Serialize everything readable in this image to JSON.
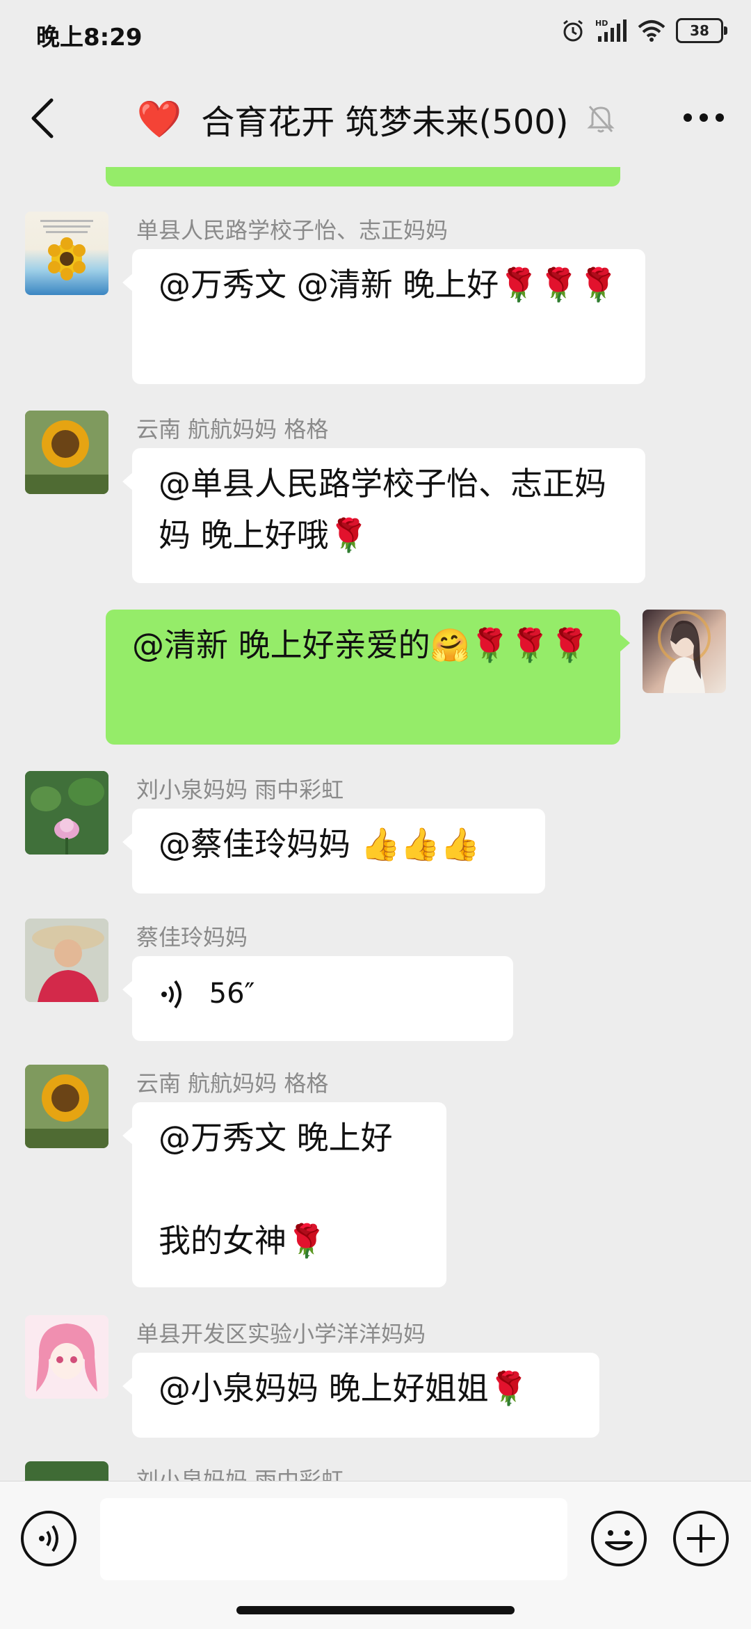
{
  "status": {
    "time": "晚上8:29",
    "battery": "38",
    "signal_label": "HD"
  },
  "header": {
    "title": "合育花开 筑梦未来(500)",
    "heart": "❤️"
  },
  "messages": [
    {
      "sender": "单县人民路学校子怡、志正妈妈",
      "text": "@万秀文 @清新  晚上好🌹🌹🌹"
    },
    {
      "sender": "云南  航航妈妈 格格",
      "text": "@单县人民路学校子怡、志正妈妈  晚上好哦🌹"
    },
    {
      "sender": "",
      "text": "@清新  晚上好亲爱的🤗🌹🌹🌹"
    },
    {
      "sender": "刘小泉妈妈  雨中彩虹",
      "text": "@蔡佳玲妈妈  👍👍👍"
    },
    {
      "sender": "蔡佳玲妈妈",
      "voice_duration": "56″"
    },
    {
      "sender": "云南  航航妈妈 格格",
      "line1": "@万秀文  晚上好",
      "line2": "我的女神🌹"
    },
    {
      "sender": "单县开发区实验小学洋洋妈妈",
      "text": "@小泉妈妈  晚上好姐姐🌹"
    },
    {
      "sender": "刘小泉妈妈  雨中彩虹"
    }
  ],
  "colors": {
    "my_bubble": "#95ec69",
    "their_bubble": "#ffffff",
    "background": "#ededed"
  },
  "icons": [
    "back-icon",
    "mute-icon",
    "more-icon",
    "voice-icon",
    "emoji-icon",
    "plus-icon"
  ]
}
